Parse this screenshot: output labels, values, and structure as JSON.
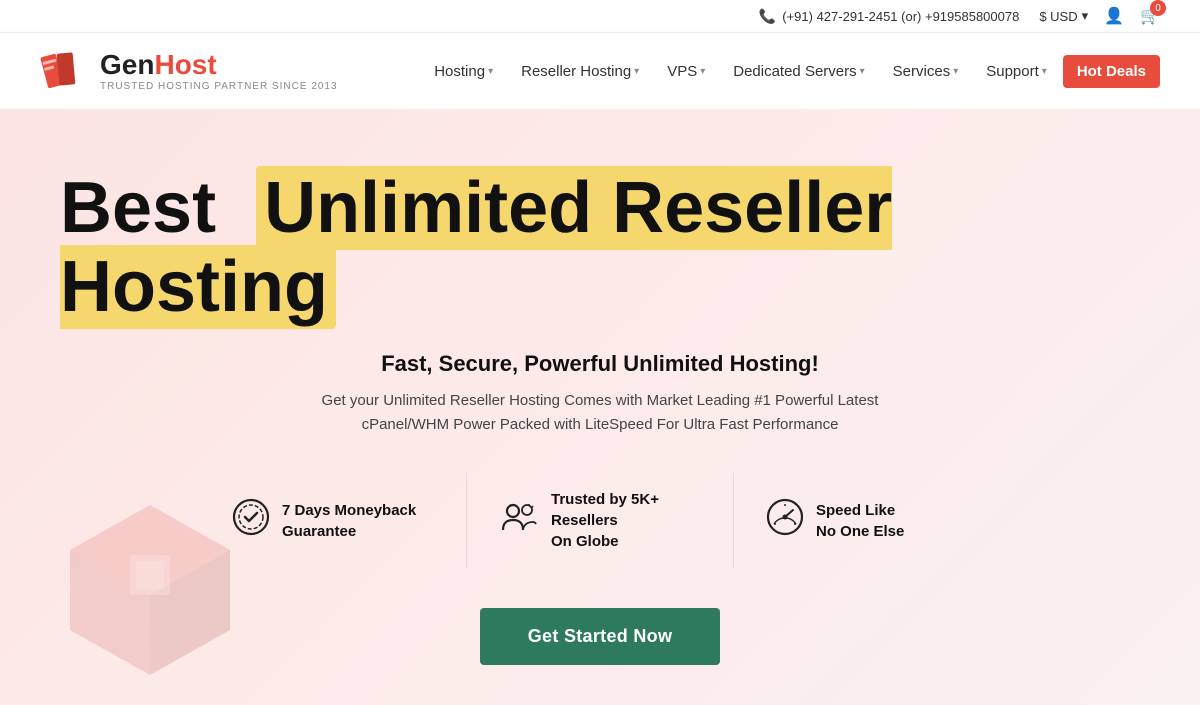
{
  "topbar": {
    "phone": "(+91) 427-291-2451 (or) +919585800078",
    "currency": "$ USD",
    "currency_arrow": "▾",
    "cart_count": "0"
  },
  "logo": {
    "gen": "Gen",
    "host": "Host",
    "tagline": "TRUSTED HOSTING PARTNER SINCE 2013"
  },
  "nav": {
    "items": [
      {
        "label": "Hosting",
        "has_dropdown": true
      },
      {
        "label": "Reseller Hosting",
        "has_dropdown": true
      },
      {
        "label": "VPS",
        "has_dropdown": true
      },
      {
        "label": "Dedicated Servers",
        "has_dropdown": true
      },
      {
        "label": "Services",
        "has_dropdown": true
      },
      {
        "label": "Support",
        "has_dropdown": true
      },
      {
        "label": "Hot Deals",
        "has_dropdown": false
      }
    ]
  },
  "hero": {
    "title_plain": "Best",
    "title_highlight": "Unlimited Reseller Hosting",
    "subtitle": "Fast, Secure, Powerful Unlimited Hosting!",
    "description": "Get your Unlimited Reseller Hosting Comes with Market Leading #1 Powerful Latest cPanel/WHM Power Packed with LiteSpeed For Ultra Fast Performance",
    "features": [
      {
        "icon": "✦",
        "icon_type": "shield-check",
        "line1": "7 Days Moneyback",
        "line2": "Guarantee"
      },
      {
        "icon": "👥",
        "icon_type": "users",
        "line1": "Trusted by 5K+ Resellers",
        "line2": "On Globe"
      },
      {
        "icon": "⚡",
        "icon_type": "speedometer",
        "line1": "Speed Like",
        "line2": "No One Else"
      }
    ],
    "cta_label": "Get Started Now"
  }
}
